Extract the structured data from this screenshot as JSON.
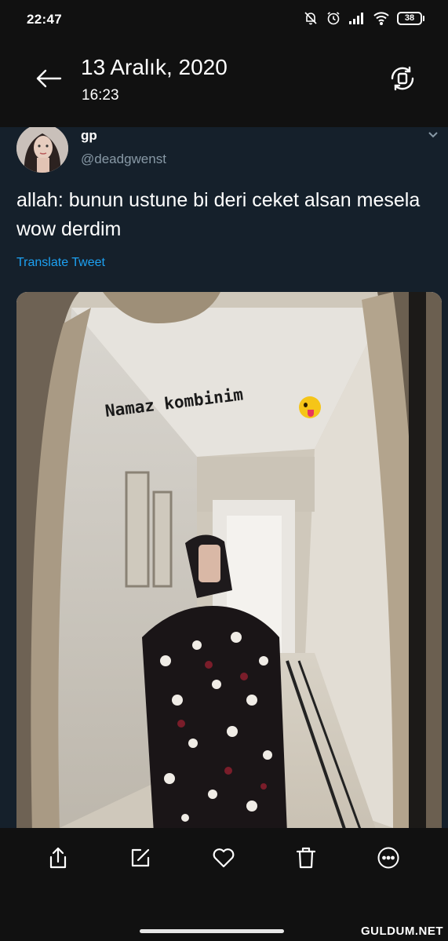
{
  "status_bar": {
    "time": "22:47",
    "icons": [
      "bell-off-icon",
      "alarm-icon",
      "signal-icon",
      "wifi-icon"
    ],
    "battery_level": "38"
  },
  "header": {
    "back_icon": "arrow-left-icon",
    "date": "13 Aralık, 2020",
    "time": "16:23",
    "rotate_icon": "screen-rotate-icon"
  },
  "tweet": {
    "display_name": "gp",
    "handle": "@deadgwenst",
    "text": "allah: bunun ustune bi deri ceket alsan mesela wow derdim",
    "translate_label": "Translate Tweet",
    "media": {
      "overlay_text": "Namaz kombinim",
      "overlay_emoji": "zany-face-emoji"
    }
  },
  "action_bar": {
    "buttons": [
      "share-icon",
      "edit-icon",
      "heart-icon",
      "trash-icon",
      "more-icon"
    ]
  },
  "watermark": "GULDUM.NET",
  "colors": {
    "background": "#111111",
    "tweet_background": "#15202b",
    "link": "#1da1f2",
    "secondary_text": "#8899a6"
  }
}
